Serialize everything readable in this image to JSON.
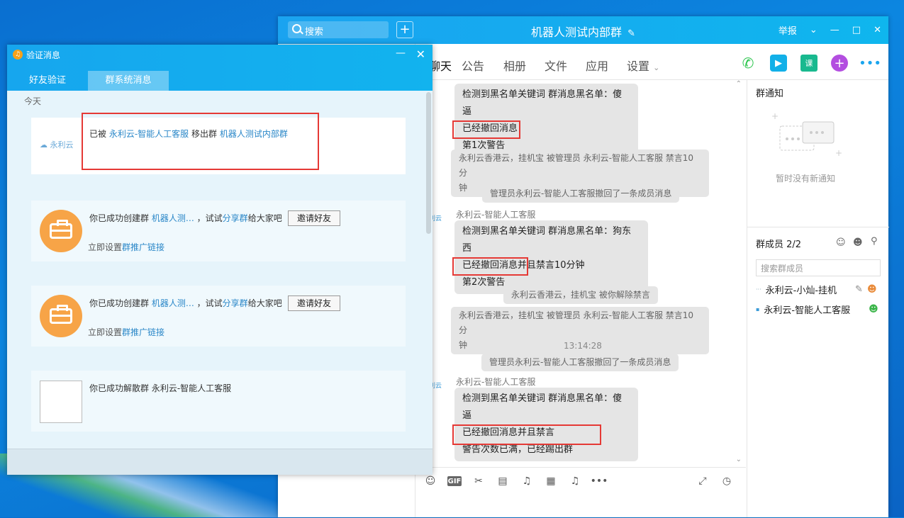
{
  "chat": {
    "search_placeholder": "搜索",
    "plus": "+",
    "title": "机器人测试内部群",
    "title_edit_icon": "✎",
    "report": "举报",
    "tabs": [
      "聊天",
      "公告",
      "相册",
      "文件",
      "应用",
      "设置"
    ],
    "messages": {
      "m1_line1": "检测到黑名单关键词 群消息黑名单：傻逼",
      "m1_line2": "已经撤回消息",
      "m1_line3": "第1次警告",
      "sys1_line1": "永利云香港云，挂机宝 被管理员 永利云-智能人工客服 禁言10分",
      "sys1_line2": "钟",
      "sys2": "管理员永利云-智能人工客服撤回了一条成员消息",
      "sender1": "永利云-智能人工客服",
      "m2_line1": "检测到黑名单关键词 群消息黑名单：狗东西",
      "m2_line2": "已经撤回消息并且禁言10分钟",
      "m2_line3": "第2次警告",
      "sys3": "永利云香港云，挂机宝 被你解除禁言",
      "sys4_line1": "永利云香港云，挂机宝 被管理员 永利云-智能人工客服 禁言10分",
      "sys4_line2": "钟",
      "time": "13:14:28",
      "sys5": "管理员永利云-智能人工客服撤回了一条成员消息",
      "sender2": "永利云-智能人工客服",
      "m3_line1": "检测到黑名单关键词 群消息黑名单：傻逼",
      "m3_line2": "已经撤回消息并且禁言",
      "m3_line3": "警告次数已满，已经踢出群"
    },
    "right": {
      "notice_title": "群通知",
      "notice_empty": "暂时没有新通知",
      "members_title": "群成员 2/2",
      "member_search": "搜索群成员",
      "members": [
        "永利云-小灿-挂机",
        "永利云-智能人工客服"
      ]
    }
  },
  "dialog": {
    "title": "验证消息",
    "tab_friend": "好友验证",
    "tab_group": "群系统消息",
    "today": "今天",
    "card1": {
      "pre": "已被 ",
      "who": "永利云-智能人工客服",
      "mid": " 移出群 ",
      "group": "机器人测试内部群"
    },
    "card2": {
      "pre": "你已成功创建群 ",
      "group": "机器人测…",
      "mid": " ，试试",
      "share": "分享群",
      "post": "给大家吧",
      "invite": "邀请好友",
      "set_pre": "立即设置",
      "set_link": "群推广链接"
    },
    "card3": {
      "pre": "你已成功创建群 ",
      "group": "机器人测…",
      "mid": " ，试试",
      "share": "分享群",
      "post": "给大家吧",
      "invite": "邀请好友",
      "set_pre": "立即设置",
      "set_link": "群推广链接"
    },
    "card4": {
      "text": "你已成功解散群 永利云-智能人工客服"
    }
  }
}
